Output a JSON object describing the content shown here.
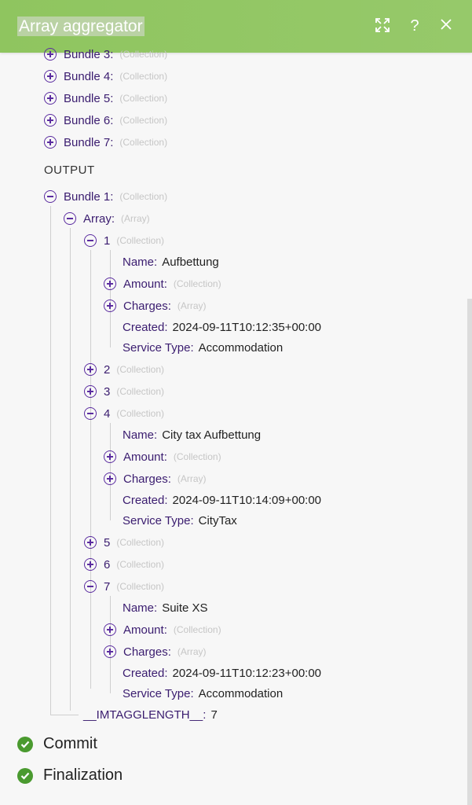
{
  "header": {
    "title": "Array aggregator"
  },
  "input_bundles": [
    {
      "label": "Bundle 3",
      "type": "(Collection)"
    },
    {
      "label": "Bundle 4",
      "type": "(Collection)"
    },
    {
      "label": "Bundle 5",
      "type": "(Collection)"
    },
    {
      "label": "Bundle 6",
      "type": "(Collection)"
    },
    {
      "label": "Bundle 7",
      "type": "(Collection)"
    }
  ],
  "output": {
    "label": "OUTPUT",
    "bundle": {
      "label": "Bundle 1",
      "type": "(Collection)"
    },
    "array": {
      "label": "Array",
      "type": "(Array)"
    },
    "items": [
      {
        "label": "1",
        "type": "(Collection)",
        "fields": {
          "name": {
            "label": "Name",
            "value": "Aufbettung"
          },
          "amount": {
            "label": "Amount",
            "type": "(Collection)"
          },
          "charges": {
            "label": "Charges",
            "type": "(Array)"
          },
          "created": {
            "label": "Created",
            "value": "2024-09-11T10:12:35+00:00"
          },
          "service": {
            "label": "Service Type",
            "value": "Accommodation"
          }
        }
      },
      {
        "label": "2",
        "type": "(Collection)"
      },
      {
        "label": "3",
        "type": "(Collection)"
      },
      {
        "label": "4",
        "type": "(Collection)",
        "fields": {
          "name": {
            "label": "Name",
            "value": "City tax Aufbettung"
          },
          "amount": {
            "label": "Amount",
            "type": "(Collection)"
          },
          "charges": {
            "label": "Charges",
            "type": "(Array)"
          },
          "created": {
            "label": "Created",
            "value": "2024-09-11T10:14:09+00:00"
          },
          "service": {
            "label": "Service Type",
            "value": "CityTax"
          }
        }
      },
      {
        "label": "5",
        "type": "(Collection)"
      },
      {
        "label": "6",
        "type": "(Collection)"
      },
      {
        "label": "7",
        "type": "(Collection)",
        "fields": {
          "name": {
            "label": "Name",
            "value": "Suite XS"
          },
          "amount": {
            "label": "Amount",
            "type": "(Collection)"
          },
          "charges": {
            "label": "Charges",
            "type": "(Array)"
          },
          "created": {
            "label": "Created",
            "value": "2024-09-11T10:12:23+00:00"
          },
          "service": {
            "label": "Service Type",
            "value": "Accommodation"
          }
        }
      }
    ],
    "tag_length": {
      "label": "__IMTAGGLENGTH__",
      "value": "7"
    }
  },
  "status": [
    {
      "label": "Commit"
    },
    {
      "label": "Finalization"
    }
  ],
  "colors": {
    "header": "#8fc55f",
    "key": "#3a1c6f",
    "toggle": "#5b2ca0",
    "check": "#4a9a2f"
  }
}
